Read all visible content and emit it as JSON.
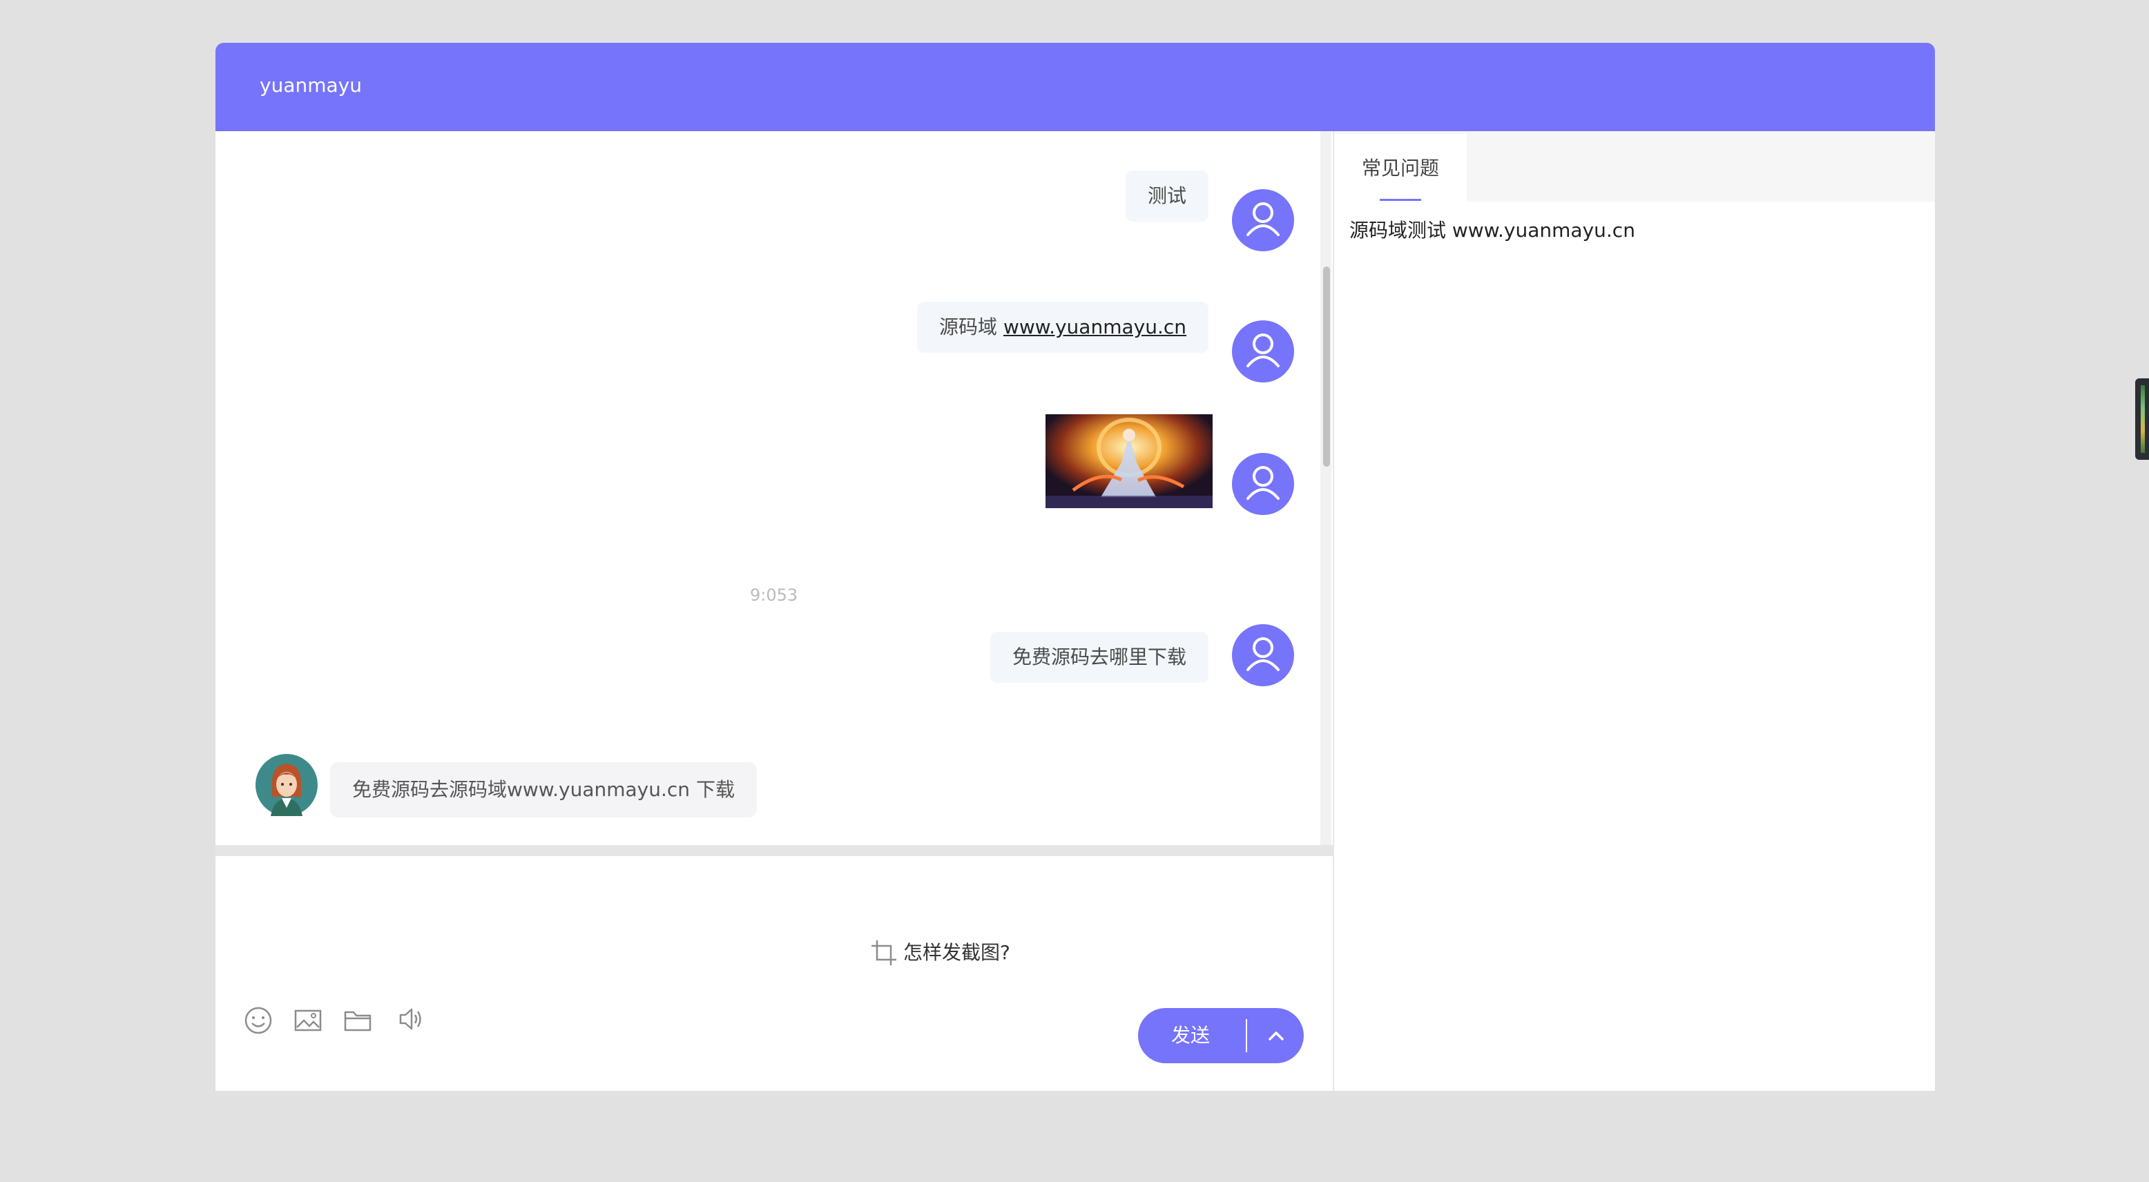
{
  "header": {
    "title": "yuanmayu"
  },
  "messages": {
    "m1": {
      "text": "测试"
    },
    "m2": {
      "prefix": "源码域 ",
      "link": "www.yuanmayu.cn"
    },
    "timestamp": "9:053",
    "m4": {
      "text": "免费源码去哪里下载"
    },
    "reply": {
      "text": "免费源码去源码域www.yuanmayu.cn 下载"
    }
  },
  "toolbar": {
    "icons": [
      "emoji-icon",
      "image-icon",
      "folder-icon",
      "volume-icon"
    ],
    "screenshot_tip": "怎样发截图?",
    "send_label": "发送"
  },
  "side_panel": {
    "tab_label": "常见问题",
    "content": "源码域测试 www.yuanmayu.cn"
  },
  "colors": {
    "accent": "#7674fb",
    "page_background": "#e1e1e1",
    "user_bubble": "#f3f6fb",
    "agent_bubble": "#f4f4f6"
  }
}
